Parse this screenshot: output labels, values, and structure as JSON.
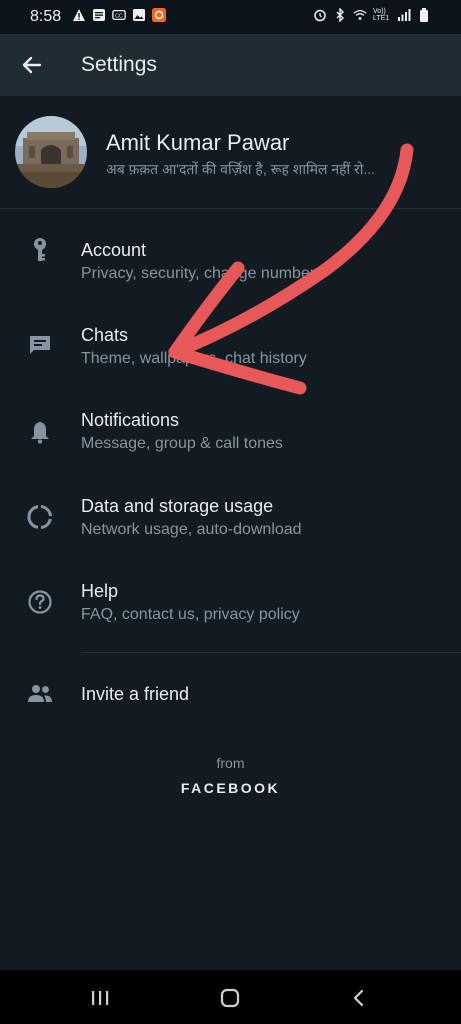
{
  "status_bar": {
    "time": "8:58",
    "network_label": "Vo)) LTE1"
  },
  "app_bar": {
    "title": "Settings"
  },
  "profile": {
    "name": "Amit Kumar Pawar",
    "status": "अब फ़क़त आ'दतों की वर्ज़िश है, रूह शामिल नहीं रो..."
  },
  "settings": [
    {
      "icon": "key-icon",
      "title": "Account",
      "subtitle": "Privacy, security, change number"
    },
    {
      "icon": "chat-icon",
      "title": "Chats",
      "subtitle": "Theme, wallpapers, chat history"
    },
    {
      "icon": "bell-icon",
      "title": "Notifications",
      "subtitle": "Message, group & call tones"
    },
    {
      "icon": "data-usage-icon",
      "title": "Data and storage usage",
      "subtitle": "Network usage, auto-download"
    },
    {
      "icon": "help-icon",
      "title": "Help",
      "subtitle": "FAQ, contact us, privacy policy"
    }
  ],
  "invite": {
    "icon": "people-icon",
    "title": "Invite a friend"
  },
  "footer": {
    "from": "from",
    "brand": "FACEBOOK"
  },
  "colors": {
    "background": "#121b22",
    "app_bar": "#1f2c34",
    "primary_text": "#e9edef",
    "secondary_text": "#8696a0",
    "annotation_arrow": "#e85858"
  }
}
